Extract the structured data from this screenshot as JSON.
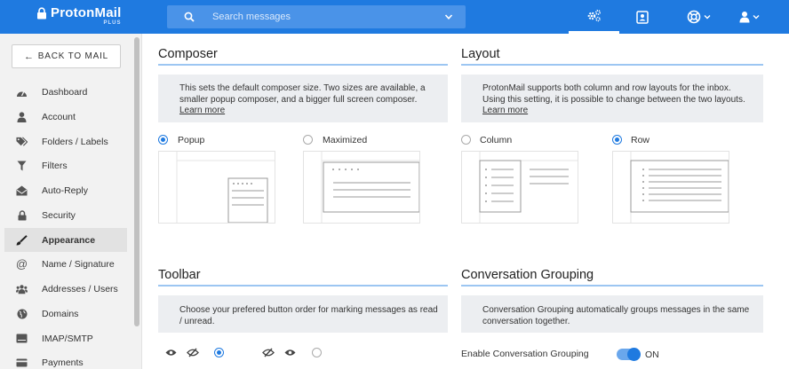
{
  "app": {
    "brand": "ProtonMail",
    "tier": "PLUS"
  },
  "search": {
    "placeholder": "Search messages"
  },
  "sidebar": {
    "back_label": "BACK TO MAIL",
    "items": [
      {
        "label": "Dashboard",
        "icon": "dashboard-icon"
      },
      {
        "label": "Account",
        "icon": "user-icon"
      },
      {
        "label": "Folders / Labels",
        "icon": "tags-icon"
      },
      {
        "label": "Filters",
        "icon": "filter-icon"
      },
      {
        "label": "Auto-Reply",
        "icon": "envelope-open-icon"
      },
      {
        "label": "Security",
        "icon": "lock-icon"
      },
      {
        "label": "Appearance",
        "icon": "paintbrush-icon",
        "active": true
      },
      {
        "label": "Name / Signature",
        "icon": "at-icon"
      },
      {
        "label": "Addresses / Users",
        "icon": "users-icon"
      },
      {
        "label": "Domains",
        "icon": "globe-icon"
      },
      {
        "label": "IMAP/SMTP",
        "icon": "server-icon"
      },
      {
        "label": "Payments",
        "icon": "credit-card-icon"
      }
    ]
  },
  "composer": {
    "title": "Composer",
    "info": "This sets the default composer size. Two sizes are available, a smaller popup composer, and a bigger full screen composer.",
    "learn_more": "Learn more",
    "options": [
      {
        "label": "Popup",
        "selected": true
      },
      {
        "label": "Maximized",
        "selected": false
      }
    ]
  },
  "layout": {
    "title": "Layout",
    "info": "ProtonMail supports both column and row layouts for the inbox. Using this setting, it is possible to change between the two layouts.",
    "learn_more": "Learn more",
    "options": [
      {
        "label": "Column",
        "selected": false
      },
      {
        "label": "Row",
        "selected": true
      }
    ]
  },
  "toolbar": {
    "title": "Toolbar",
    "info": "Choose your prefered button order for marking messages as read / unread.",
    "options": [
      {
        "order": [
          "eye-icon",
          "eye-slash-icon"
        ],
        "selected": true
      },
      {
        "order": [
          "eye-slash-icon",
          "eye-icon"
        ],
        "selected": false
      }
    ]
  },
  "conversation": {
    "title": "Conversation Grouping",
    "info": "Conversation Grouping automatically groups messages in the same conversation together.",
    "toggle_label": "Enable Conversation Grouping",
    "toggle_state": "ON",
    "enabled": true
  },
  "colors": {
    "accent": "#1f7ae0",
    "topbar": "#1f7ae0",
    "info_bg": "#eceef1"
  }
}
